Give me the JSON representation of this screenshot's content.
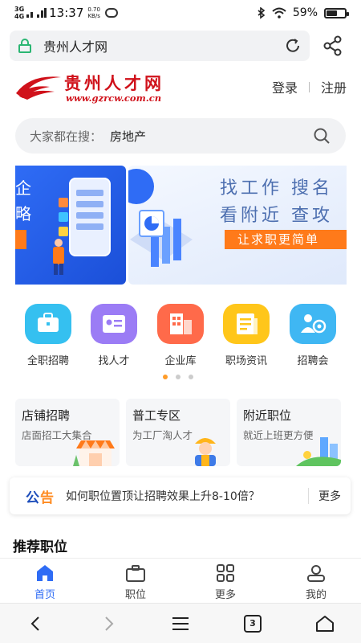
{
  "status_bar": {
    "signal_1": "3G",
    "signal_2": "4G",
    "time": "13:37",
    "net_speed_value": "0.70",
    "net_speed_unit": "KB/s",
    "battery": "59%",
    "battery_level": 0.59
  },
  "browser": {
    "url_title": "贵州人才网",
    "tab_count": "3"
  },
  "header": {
    "logo_title": "贵州人才网",
    "logo_url": "www.gzrcw.com.cn",
    "login": "登录",
    "register": "注册"
  },
  "search": {
    "label": "大家都在搜：",
    "term": "房地产"
  },
  "banner": {
    "left_fragment_1": "企",
    "left_fragment_2": "略",
    "line_1": "找工作  搜名",
    "line_2": "看附近  查攻",
    "cta": "让求职更简单"
  },
  "quick_links": [
    {
      "label": "全职招聘",
      "icon": "briefcase-icon",
      "color": "#35c0f0"
    },
    {
      "label": "找人才",
      "icon": "id-card-icon",
      "color": "#9b7cf5"
    },
    {
      "label": "企业库",
      "icon": "building-icon",
      "color": "#ff6a4a"
    },
    {
      "label": "职场资讯",
      "icon": "news-icon",
      "color": "#ffc61a"
    },
    {
      "label": "招聘会",
      "icon": "people-icon",
      "color": "#3fb7f3"
    }
  ],
  "cards": [
    {
      "title": "店铺招聘",
      "subtitle": "店面招工大集合"
    },
    {
      "title": "普工专区",
      "subtitle": "为工厂淘人才"
    },
    {
      "title": "附近职位",
      "subtitle": "就近上班更方便"
    }
  ],
  "notice": {
    "badge_1": "公",
    "badge_2": "告",
    "text": "如何职位置顶让招聘效果上升8-10倍？",
    "more": "更多"
  },
  "recommended": {
    "title": "推荐职位"
  },
  "tab_bar": [
    {
      "label": "首页",
      "icon": "home-icon",
      "active": true
    },
    {
      "label": "职位",
      "icon": "briefcase-icon",
      "active": false
    },
    {
      "label": "更多",
      "icon": "grid-icon",
      "active": false
    },
    {
      "label": "我的",
      "icon": "user-icon",
      "active": false
    }
  ],
  "colors": {
    "brand_red": "#d0121b",
    "accent_blue": "#2f6cf5",
    "accent_orange": "#ff7a1a"
  }
}
